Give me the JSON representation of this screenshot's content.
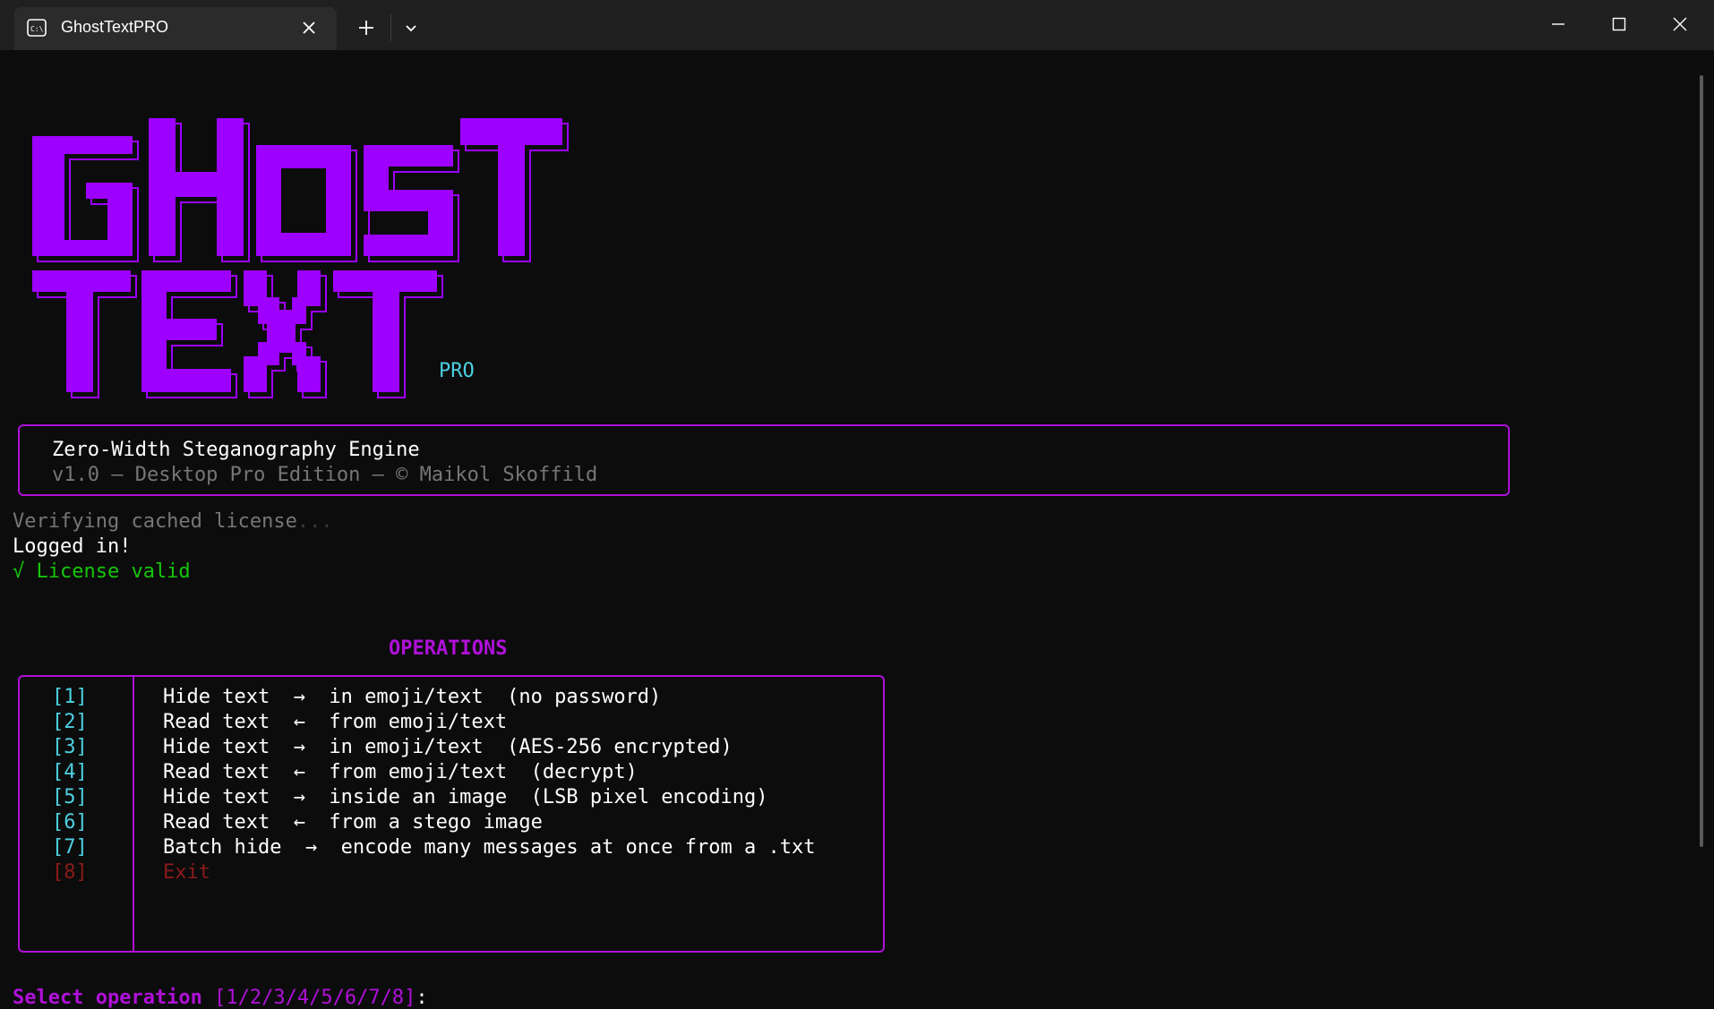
{
  "window": {
    "tab_title": "GhostTextPRO",
    "tab_icon": "terminal-icon",
    "controls": [
      "minimize-icon",
      "maximize-icon",
      "close-icon"
    ]
  },
  "logo": {
    "line1": "GHOST",
    "line2": "TEXT",
    "tag": "PRO",
    "color": "#9d00ff"
  },
  "header": {
    "title": "Zero-Width Steganography Engine",
    "subtitle": "v1.0 — Desktop Pro Edition — © Maikol Skoffild"
  },
  "status": {
    "verifying": "Verifying cached license",
    "verifying_dots": "...",
    "logged_in": "Logged in!",
    "license_valid": "√ License valid"
  },
  "operations": {
    "title": "OPERATIONS",
    "items": [
      {
        "key": "[1]",
        "text": "Hide text  →  in emoji/text  (no password)"
      },
      {
        "key": "[2]",
        "text": "Read text  ←  from emoji/text"
      },
      {
        "key": "[3]",
        "text": "Hide text  →  in emoji/text  (AES-256 encrypted)"
      },
      {
        "key": "[4]",
        "text": "Read text  ←  from emoji/text  (decrypt)"
      },
      {
        "key": "[5]",
        "text": "Hide text  →  inside an image  (LSB pixel encoding)"
      },
      {
        "key": "[6]",
        "text": "Read text  ←  from a stego image"
      },
      {
        "key": "[7]",
        "text": "Batch hide  →  encode many messages at once from a .txt"
      },
      {
        "key": "[8]",
        "text": "Exit"
      }
    ]
  },
  "prompt": {
    "label": "Select operation",
    "choices": "[1/2/3/4/5/6/7/8]",
    "colon": ":"
  },
  "colors": {
    "accent_purple": "#b010d8",
    "cyan": "#4dd0e1",
    "success_green": "#16c60c",
    "exit_red": "#8b1a1a",
    "background": "#0c0c0c"
  }
}
